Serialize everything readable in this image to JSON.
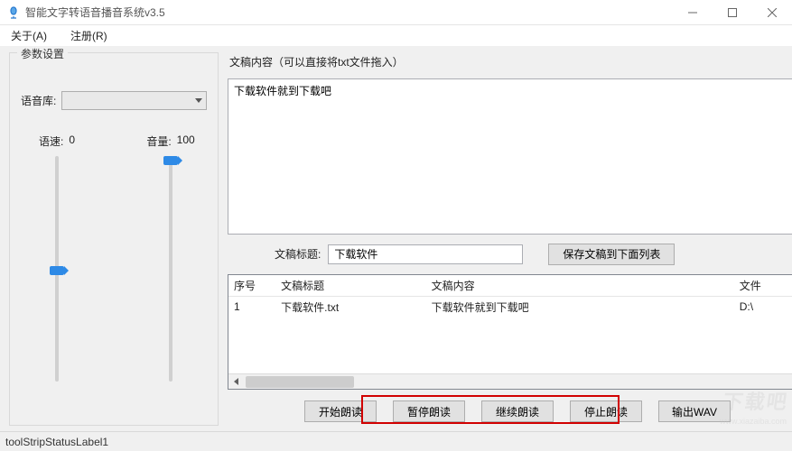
{
  "window": {
    "title": "智能文字转语音播音系统v3.5"
  },
  "menu": {
    "about": "关于(A)",
    "register": "注册(R)"
  },
  "params": {
    "legend": "参数设置",
    "voice_label": "语音库:",
    "voice_value": "",
    "rate_label": "语速:",
    "rate_value": "0",
    "volume_label": "音量:",
    "volume_value": "100"
  },
  "content": {
    "hint": "文稿内容（可以直接将txt文件拖入）",
    "text": "下载软件就到下载吧",
    "title_label": "文稿标题:",
    "title_value": "下载软件",
    "save_to_list": "保存文稿到下面列表"
  },
  "list": {
    "col_index": "序号",
    "col_title": "文稿标题",
    "col_content": "文稿内容",
    "col_file": "文件",
    "rows": [
      {
        "index": "1",
        "title": "下载软件.txt",
        "content": "下载软件就到下载吧",
        "file": "D:\\"
      }
    ]
  },
  "buttons": {
    "start": "开始朗读",
    "pause": "暂停朗读",
    "resume": "继续朗读",
    "stop": "停止朗读",
    "output_wav": "输出WAV"
  },
  "status": {
    "label": "toolStripStatusLabel1"
  },
  "watermark": {
    "main": "下载吧",
    "sub": "www.xiazaiba.com"
  }
}
